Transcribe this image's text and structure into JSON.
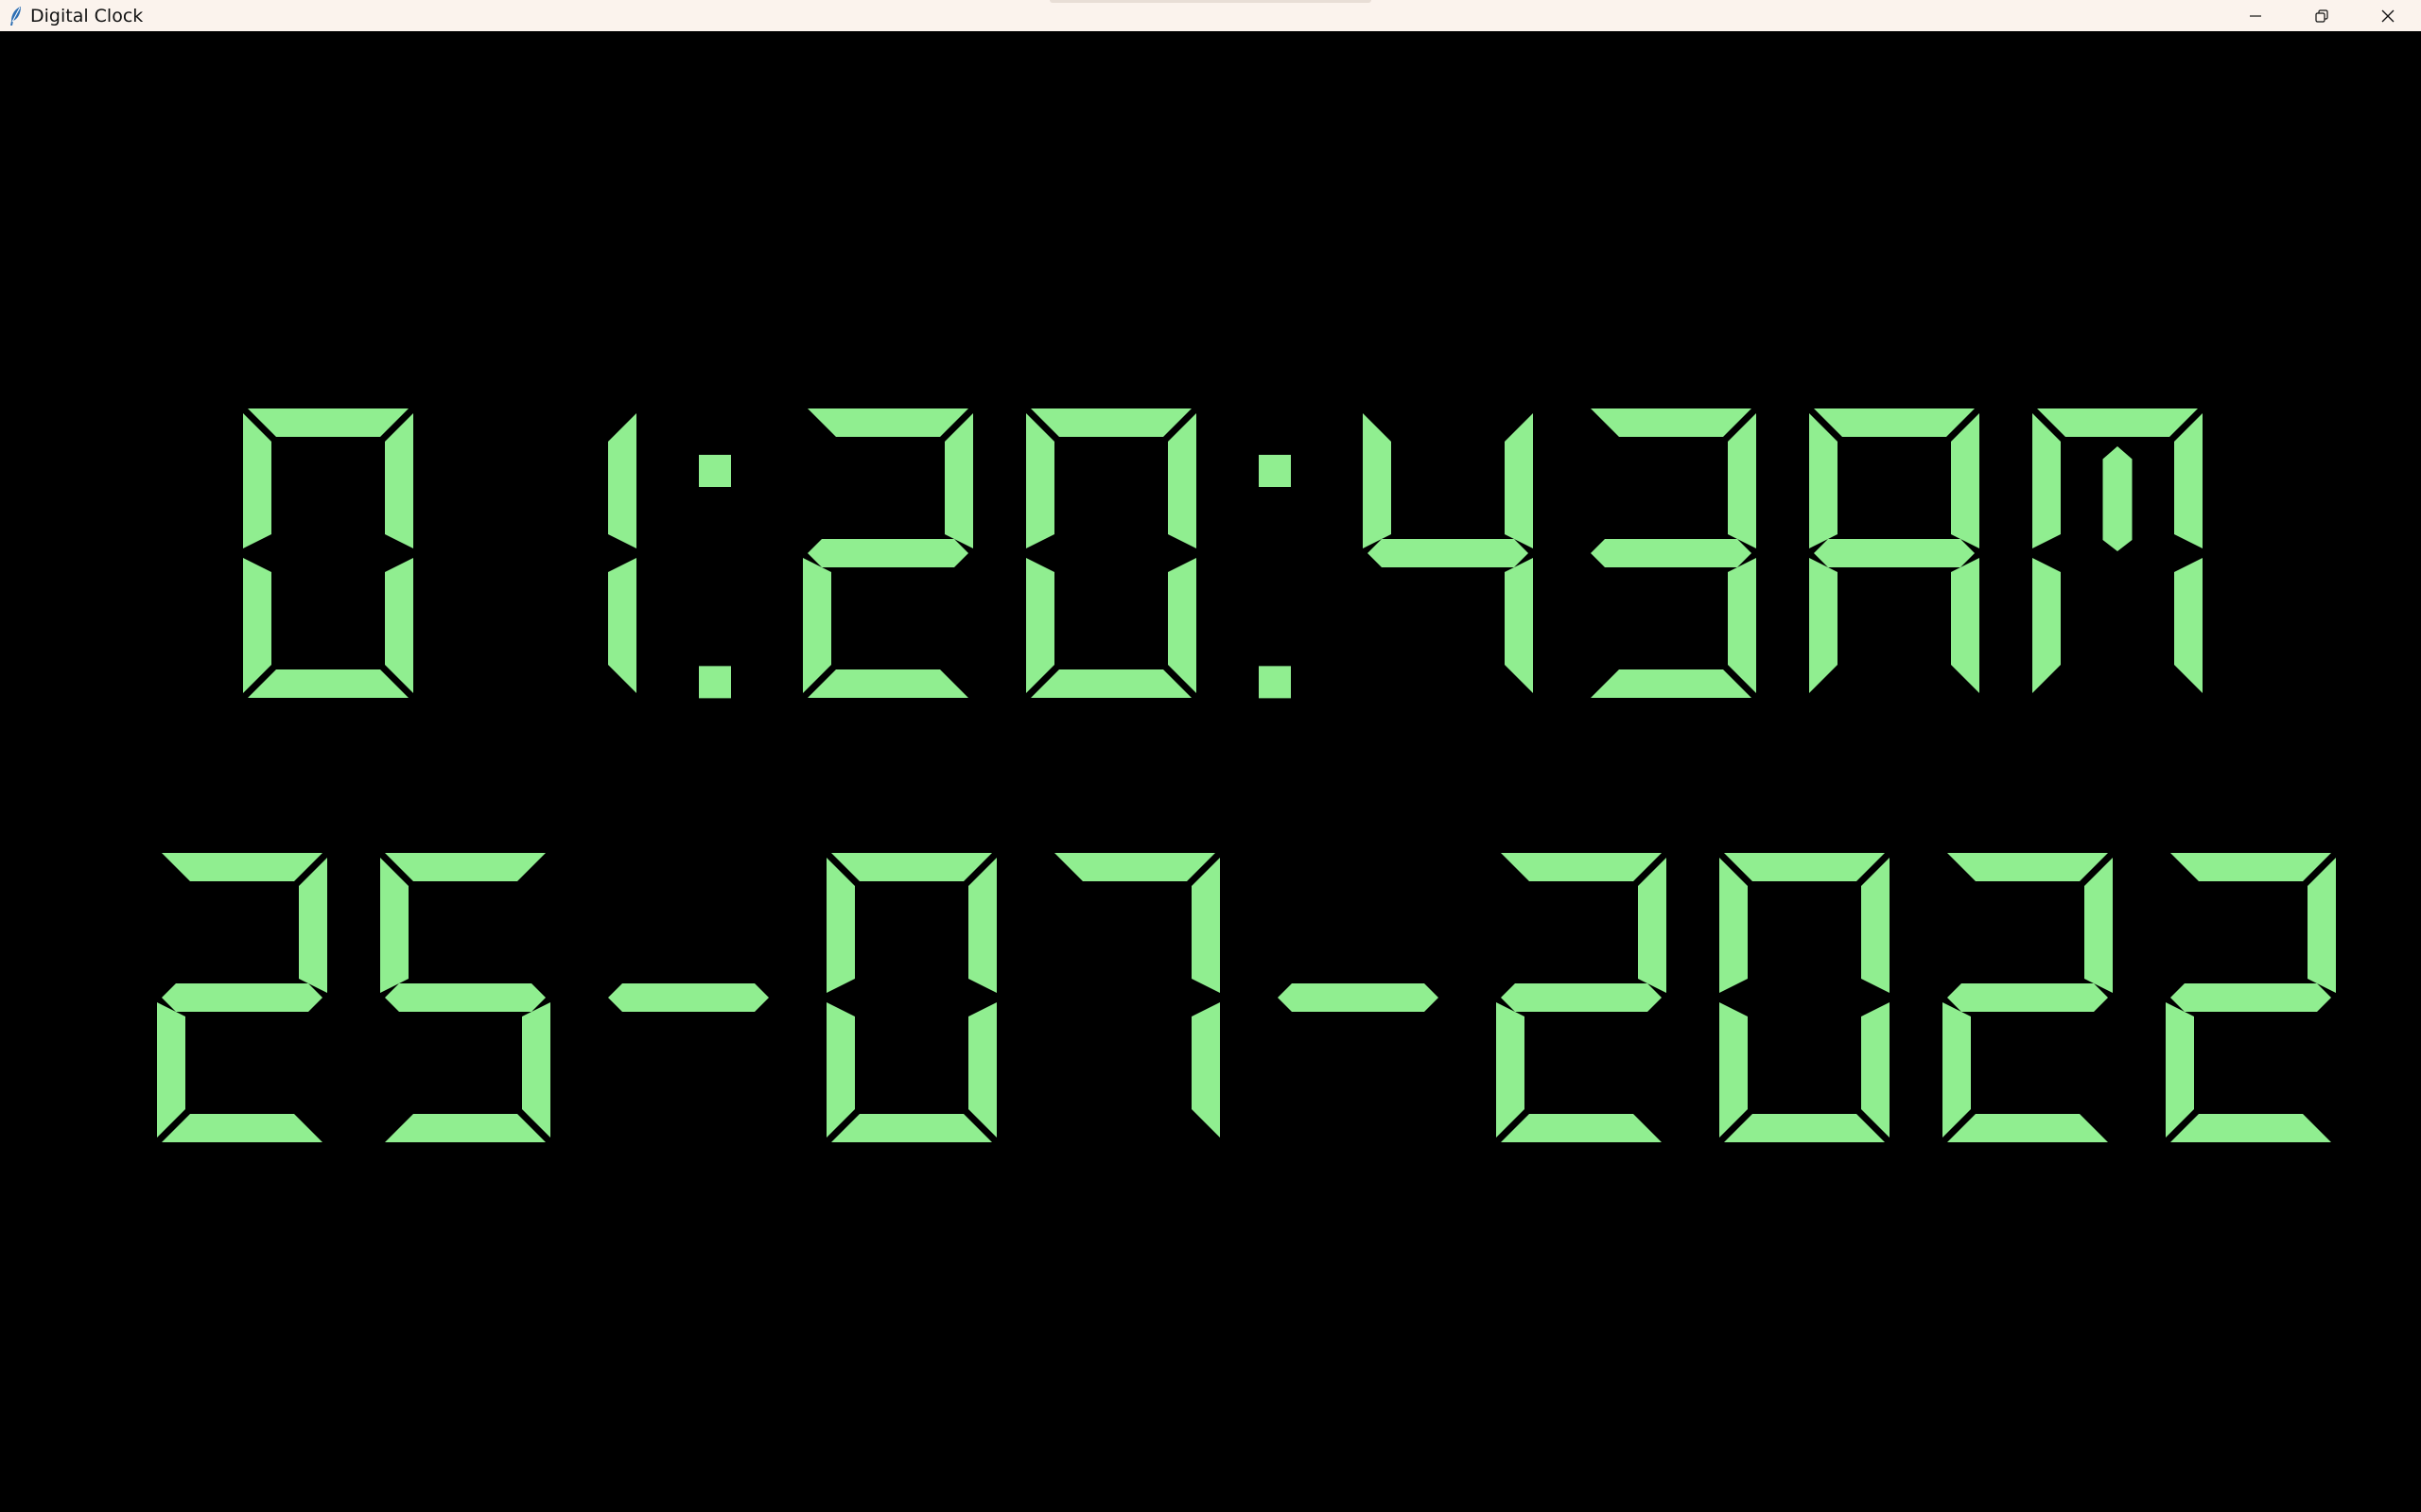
{
  "window": {
    "title": "Digital Clock",
    "controls": [
      "minimize-icon",
      "restore-icon",
      "close-icon"
    ]
  },
  "clock": {
    "time": "01:20:43 AM",
    "date": "25-07-2022"
  },
  "colors": {
    "segment": "#90ee90",
    "background": "#000000",
    "titlebar": "#fbf3ed"
  }
}
